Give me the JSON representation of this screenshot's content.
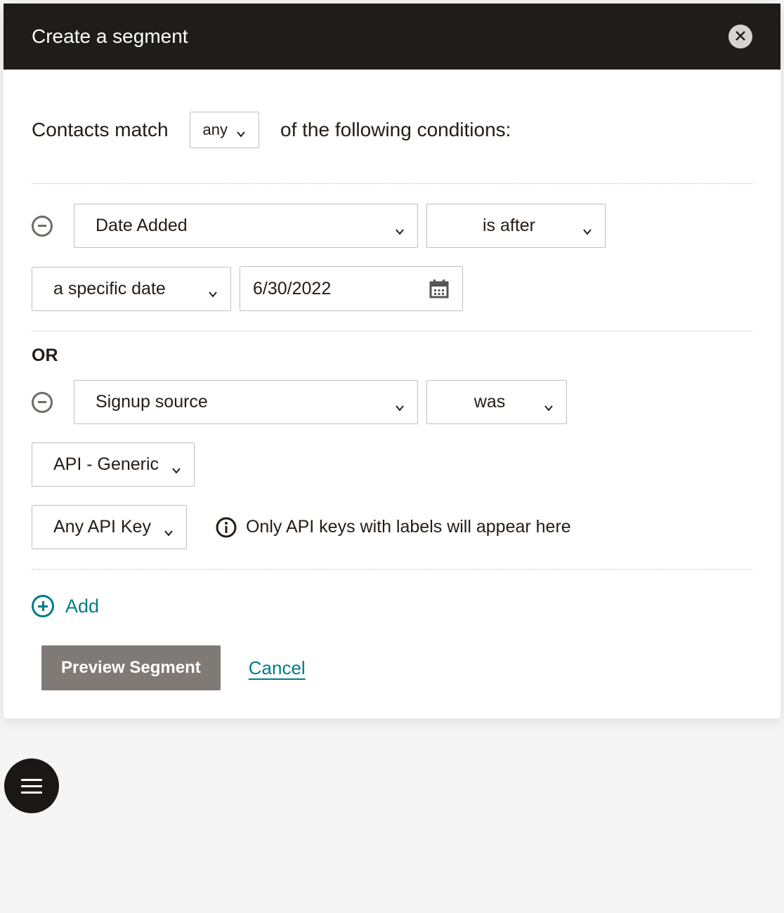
{
  "header": {
    "title": "Create a segment"
  },
  "match": {
    "prefix": "Contacts match",
    "selector": "any",
    "suffix": "of the following conditions:"
  },
  "conditions": [
    {
      "field": "Date Added",
      "operator": "is after",
      "dateMode": "a specific date",
      "dateValue": "6/30/2022"
    },
    {
      "joiner": "OR",
      "field": "Signup source",
      "operator": "was",
      "value1": "API - Generic",
      "value2": "Any API Key",
      "infoText": "Only API keys with labels will appear here"
    }
  ],
  "addLabel": "Add",
  "actions": {
    "preview": "Preview Segment",
    "cancel": "Cancel"
  }
}
